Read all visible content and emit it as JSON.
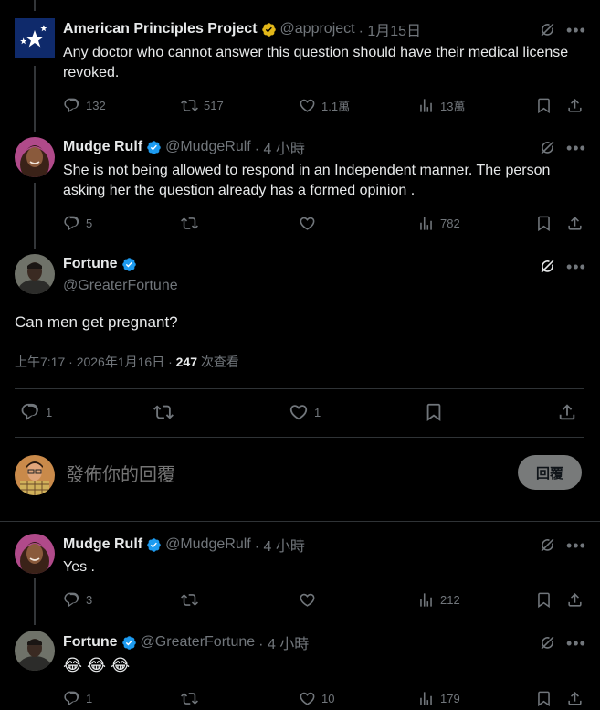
{
  "tweets": [
    {
      "name": "American Principles Project",
      "handle": "@approject",
      "time": "· 1月15日",
      "text": "Any doctor who cannot answer this question should have their medical license revoked.",
      "replies": "132",
      "retweets": "517",
      "likes": "1.1萬",
      "views": "13萬"
    },
    {
      "name": "Mudge Rulf",
      "handle": "@MudgeRulf",
      "time": "· 4 小時",
      "text": "She is not being allowed to respond in an Independent manner. The person asking her the question  already has a formed opinion .",
      "replies": "5",
      "retweets": "",
      "likes": "",
      "views": "782"
    }
  ],
  "focus": {
    "name": "Fortune",
    "handle": "@GreaterFortune",
    "text": "Can men get pregnant?",
    "timestamp": "上午7:17 · 2026年1月16日 · ",
    "views_count": "247",
    "views_label": " 次查看",
    "replies": "1",
    "likes": "1"
  },
  "compose": {
    "placeholder": "發佈你的回覆",
    "button": "回覆"
  },
  "replies": [
    {
      "name": "Mudge Rulf",
      "handle": "@MudgeRulf",
      "time": "· 4 小時",
      "text": "Yes .",
      "replies": "3",
      "likes": "",
      "views": "212"
    },
    {
      "name": "Fortune",
      "handle": "@GreaterFortune",
      "time": "· 4 小時",
      "text": "😂 😂 😂",
      "replies": "1",
      "likes": "10",
      "views": "179"
    }
  ],
  "colors": {
    "background": "#000000",
    "text": "#e7e9ea",
    "muted": "#71767b",
    "verified_blue": "#1d9bf0",
    "verified_gold": "#e2b719"
  }
}
